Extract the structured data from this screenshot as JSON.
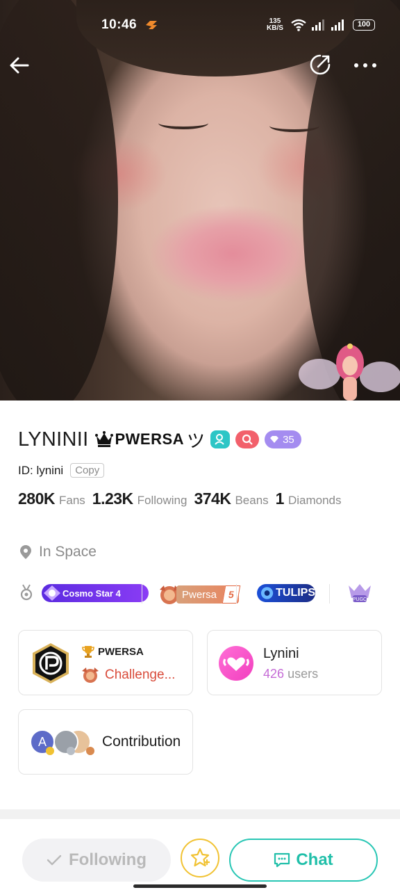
{
  "status_bar": {
    "time": "10:46",
    "net_speed_top": "135",
    "net_speed_bottom": "KB/S",
    "battery": "100"
  },
  "nav": {
    "back_icon": "arrow-left-icon",
    "share_icon": "share-icon",
    "more_icon": "more-dots-icon"
  },
  "profile": {
    "name": "LYNINII",
    "clan_tag": "PWERSA",
    "clan_suffix": "ツ",
    "level_badge": "35",
    "id_label": "ID: lynini",
    "copy_label": "Copy",
    "stats": [
      {
        "value": "280K",
        "label": "Fans"
      },
      {
        "value": "1.23K",
        "label": "Following"
      },
      {
        "value": "374K",
        "label": "Beans"
      },
      {
        "value": "1",
        "label": "Diamonds"
      }
    ],
    "location": "In Space"
  },
  "badges": {
    "cosmo": "Cosmo Star 4",
    "pwersa": "Pwersa",
    "pwersa_level": "5",
    "tulips": "TULIPS",
    "pugc": "PUGC"
  },
  "cards": {
    "clan": {
      "title": "PWERSA",
      "subtitle": "Challenge..."
    },
    "fan_club": {
      "name": "Lynini",
      "count": "426",
      "count_suffix": "users"
    },
    "contribution": {
      "label": "Contribution",
      "first_avatar_letter": "A"
    }
  },
  "actions": {
    "following": "Following",
    "chat": "Chat"
  },
  "colors": {
    "teal": "#28c6b4",
    "level_purple": "#a48cf0",
    "chip_teal": "#2cc6c6",
    "chip_red": "#f2606b",
    "gold": "#f1c232"
  }
}
